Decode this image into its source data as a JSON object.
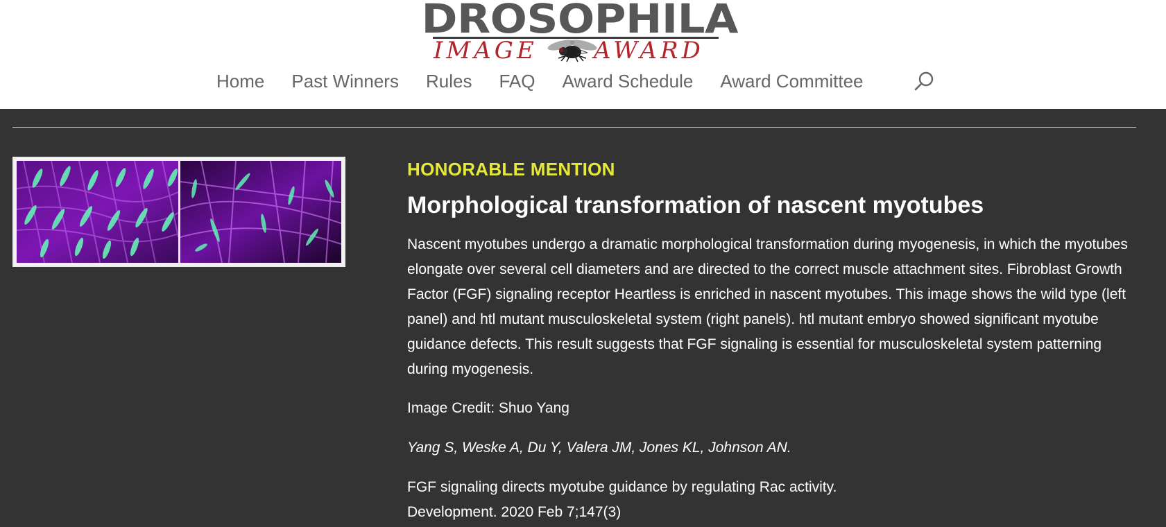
{
  "header": {
    "logo": {
      "top_text": "DROSOPHILA",
      "bottom_left": "IMAGE",
      "bottom_right": "AWARD"
    },
    "nav": [
      {
        "label": "Home"
      },
      {
        "label": "Past Winners"
      },
      {
        "label": "Rules"
      },
      {
        "label": "FAQ"
      },
      {
        "label": "Award Schedule"
      },
      {
        "label": "Award Committee"
      }
    ],
    "search_icon": "search-icon"
  },
  "entry": {
    "award": "HONORABLE MENTION",
    "title": "Morphological transformation of nascent myotubes",
    "description": "Nascent myotubes undergo a dramatic morphological transformation during myogenesis, in which the myotubes elongate over several cell diameters and are directed to the correct muscle attachment sites. Fibroblast Growth Factor (FGF) signaling receptor Heartless is enriched in nascent myotubes. This image shows the wild type (left panel) and htl mutant musculoskeletal system (right panels). htl mutant embryo showed significant myotube guidance defects. This result suggests that FGF signaling is essential for musculoskeletal system patterning during myogenesis.",
    "credit": "Image Credit: Shuo Yang",
    "authors": "Yang S, Weske A, Du Y, Valera JM, Jones KL, Johnson AN.",
    "citation_title": "FGF signaling directs myotube guidance by regulating Rac activity.",
    "citation_journal": "Development. 2020 Feb 7;147(3)"
  },
  "colors": {
    "background": "#333333",
    "header_bg": "#ffffff",
    "nav_text": "#666666",
    "award_yellow": "#e6e93a",
    "logo_red": "#b0242b",
    "logo_gray": "#575757",
    "micrograph_magenta": "#a21fd4",
    "micrograph_green": "#5ef0b0"
  }
}
